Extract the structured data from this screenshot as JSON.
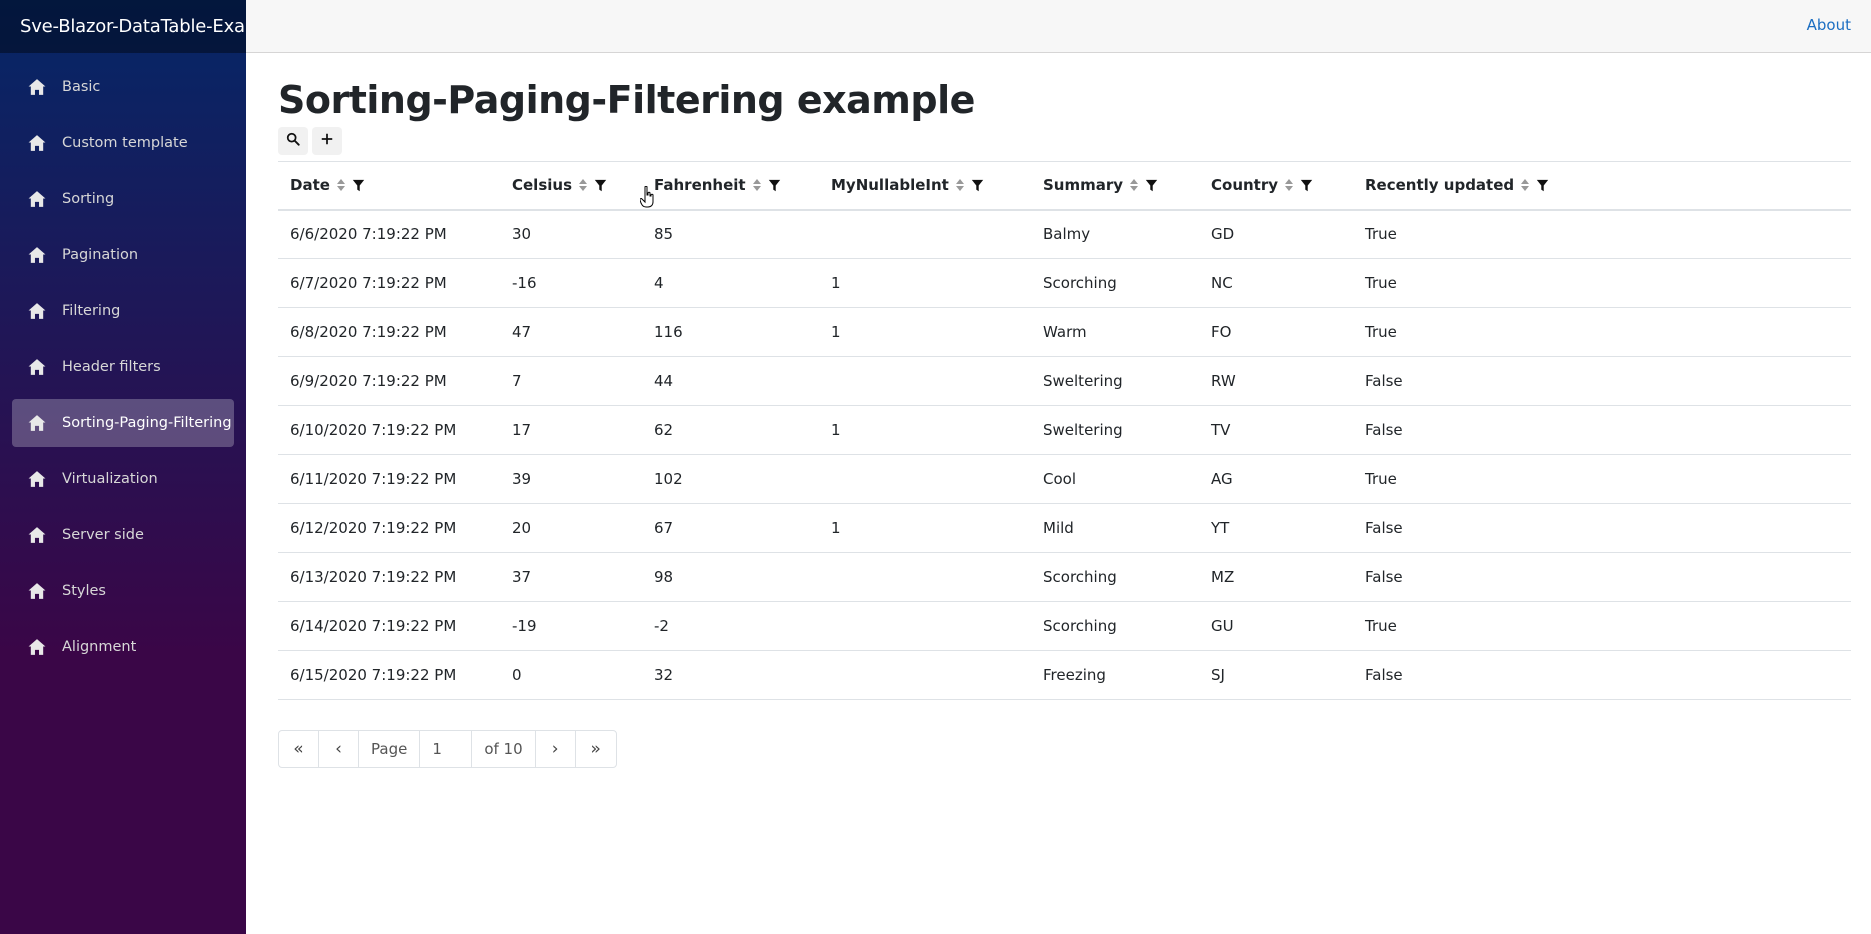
{
  "app": {
    "brand": "Sve-Blazor-DataTable-Example"
  },
  "topbar": {
    "about": "About"
  },
  "sidebar": {
    "items": [
      {
        "label": "Basic",
        "icon": "home-icon"
      },
      {
        "label": "Custom template",
        "icon": "home-icon"
      },
      {
        "label": "Sorting",
        "icon": "home-icon"
      },
      {
        "label": "Pagination",
        "icon": "home-icon"
      },
      {
        "label": "Filtering",
        "icon": "home-icon"
      },
      {
        "label": "Header filters",
        "icon": "home-icon"
      },
      {
        "label": "Sorting-Paging-Filtering",
        "icon": "home-icon",
        "active": true
      },
      {
        "label": "Virtualization",
        "icon": "home-icon"
      },
      {
        "label": "Server side",
        "icon": "home-icon"
      },
      {
        "label": "Styles",
        "icon": "home-icon"
      },
      {
        "label": "Alignment",
        "icon": "home-icon"
      }
    ]
  },
  "main": {
    "title": "Sorting-Paging-Filtering example",
    "toolbar": {
      "search_icon": "search-icon",
      "add_icon": "plus-icon"
    },
    "columns": [
      "Date",
      "Celsius",
      "Fahrenheit",
      "MyNullableInt",
      "Summary",
      "Country",
      "Recently updated"
    ],
    "rows": [
      [
        "6/6/2020 7:19:22 PM",
        "30",
        "85",
        "",
        "Balmy",
        "GD",
        "True"
      ],
      [
        "6/7/2020 7:19:22 PM",
        "-16",
        "4",
        "1",
        "Scorching",
        "NC",
        "True"
      ],
      [
        "6/8/2020 7:19:22 PM",
        "47",
        "116",
        "1",
        "Warm",
        "FO",
        "True"
      ],
      [
        "6/9/2020 7:19:22 PM",
        "7",
        "44",
        "",
        "Sweltering",
        "RW",
        "False"
      ],
      [
        "6/10/2020 7:19:22 PM",
        "17",
        "62",
        "1",
        "Sweltering",
        "TV",
        "False"
      ],
      [
        "6/11/2020 7:19:22 PM",
        "39",
        "102",
        "",
        "Cool",
        "AG",
        "True"
      ],
      [
        "6/12/2020 7:19:22 PM",
        "20",
        "67",
        "1",
        "Mild",
        "YT",
        "False"
      ],
      [
        "6/13/2020 7:19:22 PM",
        "37",
        "98",
        "",
        "Scorching",
        "MZ",
        "False"
      ],
      [
        "6/14/2020 7:19:22 PM",
        "-19",
        "-2",
        "",
        "Scorching",
        "GU",
        "True"
      ],
      [
        "6/15/2020 7:19:22 PM",
        "0",
        "32",
        "",
        "Freezing",
        "SJ",
        "False"
      ]
    ],
    "pager": {
      "first": "«",
      "prev": "‹",
      "page_label": "Page",
      "page_value": "1",
      "of_label": "of 10",
      "next": "›",
      "last": "»"
    }
  },
  "colors": {
    "sidebar_top": "#052767",
    "sidebar_bottom": "#3a0647",
    "link": "#1b6ec2"
  }
}
